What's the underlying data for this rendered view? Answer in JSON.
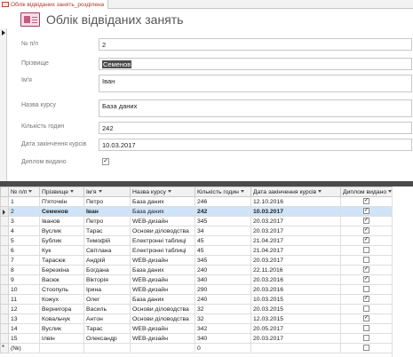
{
  "tab": {
    "label": "Облік відвіданих занять_розділена"
  },
  "header": {
    "title": "Облік відвіданих занять"
  },
  "detail_form": {
    "fields": [
      {
        "label": "№ п/п",
        "value": "2"
      },
      {
        "label": "Прізвище",
        "value": "Семенов"
      },
      {
        "label": "Ім'я",
        "value": "Іван"
      },
      {
        "label": "Назва курсу",
        "value": "База даних"
      },
      {
        "label": "Кількість годин",
        "value": "242"
      },
      {
        "label": "Дата закінчення курсів",
        "value": "10.03.2017"
      }
    ],
    "checkbox_label": "Диплом видано",
    "checkbox_checked": "✓"
  },
  "table": {
    "columns": [
      "№ п/п",
      "Прізвище",
      "Ім'я",
      "Назва курсу",
      "Кількість годин",
      "Дата закінчення курсів",
      "Диплом видано"
    ],
    "current_row_index": 1,
    "rows": [
      {
        "num": "1",
        "surname": "П'яточкін",
        "name": "Петро",
        "course": "База даних",
        "hours": "246",
        "date": "12.10.2016",
        "diploma": true
      },
      {
        "num": "2",
        "surname": "Семенов",
        "name": "Іван",
        "course": "База даних",
        "hours": "242",
        "date": "10.03.2017",
        "diploma": true
      },
      {
        "num": "3",
        "surname": "Іванов",
        "name": "Петро",
        "course": "WEB-дизайн",
        "hours": "345",
        "date": "20.03.2017",
        "diploma": true
      },
      {
        "num": "4",
        "surname": "Вуслик",
        "name": "Тарас",
        "course": "Основи діловодства",
        "hours": "34",
        "date": "20.03.2017",
        "diploma": true
      },
      {
        "num": "5",
        "surname": "Бублик",
        "name": "Тимофій",
        "course": "Електронні таблиці",
        "hours": "45",
        "date": "21.04.2017",
        "diploma": true
      },
      {
        "num": "6",
        "surname": "Кук",
        "name": "Світлана",
        "course": "Електронні таблиці",
        "hours": "45",
        "date": "21.04.2017",
        "diploma": false
      },
      {
        "num": "7",
        "surname": "Тарасюк",
        "name": "Андрій",
        "course": "WEB-дизайн",
        "hours": "345",
        "date": "20.03.2017",
        "diploma": false
      },
      {
        "num": "8",
        "surname": "Березкіна",
        "name": "Богдана",
        "course": "База даних",
        "hours": "240",
        "date": "22.11.2016",
        "diploma": true
      },
      {
        "num": "9",
        "surname": "Васюк",
        "name": "Вікторія",
        "course": "WEB-дизайн",
        "hours": "340",
        "date": "20.03.2016",
        "diploma": true
      },
      {
        "num": "10",
        "surname": "Стоопуль",
        "name": "Ірина",
        "course": "WEB-дизайн",
        "hours": "290",
        "date": "20.03.2016",
        "diploma": false
      },
      {
        "num": "11",
        "surname": "Кожух",
        "name": "Олег",
        "course": "База даних",
        "hours": "240",
        "date": "10.03.2015",
        "diploma": true
      },
      {
        "num": "12",
        "surname": "Вернигора",
        "name": "Василь",
        "course": "Основи діловодства",
        "hours": "32",
        "date": "20.03.2015",
        "diploma": false
      },
      {
        "num": "13",
        "surname": "Ковальчук",
        "name": "Антон",
        "course": "Основи діловодства",
        "hours": "32",
        "date": "12.03.2015",
        "diploma": true
      },
      {
        "num": "14",
        "surname": "Вуслик",
        "name": "Тарас",
        "course": "WEB-дизайн",
        "hours": "342",
        "date": "20.05.2017",
        "diploma": false
      },
      {
        "num": "15",
        "surname": "Ілвін",
        "name": "Олександр",
        "course": "WEB-дизайн",
        "hours": "340",
        "date": "20.03.2017",
        "diploma": false
      }
    ],
    "new_row": {
      "num": "(№)",
      "hours": "0",
      "diploma": false
    }
  }
}
